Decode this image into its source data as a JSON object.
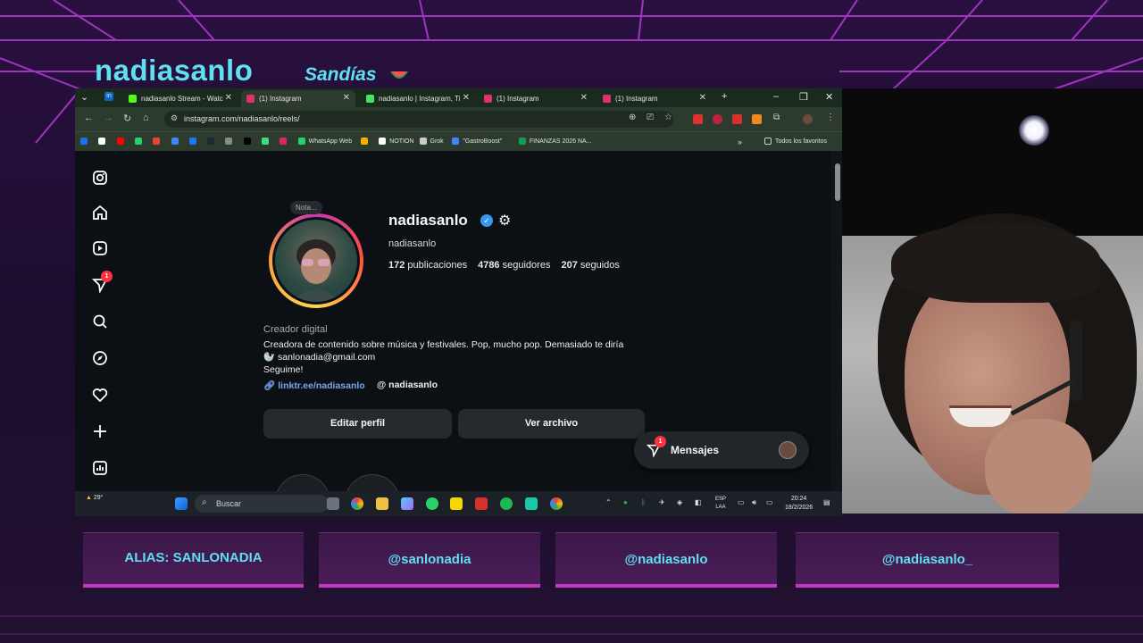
{
  "overlay": {
    "title": "nadiasanlo",
    "subtitle": "Sandías",
    "colors": {
      "accent": "#5ee0f0",
      "neon": "#c03ac0"
    }
  },
  "browser": {
    "tabs": [
      {
        "label": "nadiasanlo Stream - Watc",
        "icon": "kick-icon",
        "color": "#53fc18"
      },
      {
        "label": "(1) Instagram",
        "icon": "instagram-icon",
        "color": "#e1306c",
        "active": true
      },
      {
        "label": "nadiasanlo | Instagram, Ti",
        "icon": "linktree-icon",
        "color": "#43e660"
      },
      {
        "label": "(1) Instagram",
        "icon": "instagram-icon",
        "color": "#e1306c"
      },
      {
        "label": "(1) Instagram",
        "icon": "instagram-icon",
        "color": "#e1306c"
      }
    ],
    "url": "instagram.com/nadiasanlo/reels/",
    "bookmarks": [
      {
        "label": "",
        "color": "#1a73e8"
      },
      {
        "label": "",
        "color": "#ffffff"
      },
      {
        "label": "",
        "color": "#ff0000"
      },
      {
        "label": "",
        "color": "#25d366"
      },
      {
        "label": "",
        "color": "#ea4335"
      },
      {
        "label": "",
        "color": "#4285f4"
      },
      {
        "label": "",
        "color": "#1877f2"
      },
      {
        "label": "",
        "color": "#1b2838"
      },
      {
        "label": "",
        "color": "#888888"
      },
      {
        "label": "",
        "color": "#000000"
      },
      {
        "label": "",
        "color": "#3ddc84"
      },
      {
        "label": "",
        "color": "#e0245e"
      },
      {
        "label": "WhatsApp Web",
        "color": "#25d366"
      },
      {
        "label": "",
        "color": "#f4b400"
      },
      {
        "label": "NOTION",
        "color": "#ffffff"
      },
      {
        "label": "Grok",
        "color": "#cccccc"
      },
      {
        "label": "\"GastroBoost\"",
        "color": "#4285f4"
      },
      {
        "label": "FINANZAS 2026 NA...",
        "color": "#0f9d58"
      }
    ],
    "all_bookmarks": "Todos los favoritos"
  },
  "profile": {
    "note": "Nota...",
    "username": "nadiasanlo",
    "handle": "nadiasanlo",
    "stats": {
      "posts": "172",
      "posts_label": "publicaciones",
      "followers": "4786",
      "followers_label": "seguidores",
      "following": "207",
      "following_label": "seguidos"
    },
    "category": "Creador digital",
    "bio": [
      "Creadora de contenido sobre música y festivales. Pop, mucho pop. Demasiado te diría",
      "🦭 sanlonadia@gmail.com",
      "Seguime!"
    ],
    "link": "linktr.ee/nadiasanlo",
    "threads": "nadiasanlo",
    "edit_button": "Editar perfil",
    "archive_button": "Ver archivo",
    "messages": "Mensajes",
    "messages_badge": "1",
    "notif_badge": "1"
  },
  "taskbar": {
    "weather": "29°",
    "search": "Buscar",
    "lang": "ESP",
    "lang2": "LAA",
    "time": "20:24",
    "date": "18/2/2026"
  },
  "panels": [
    "ALIAS: SANLONADIA",
    "@sanlonadia",
    "@nadiasanlo",
    "@nadiasanlo_"
  ]
}
